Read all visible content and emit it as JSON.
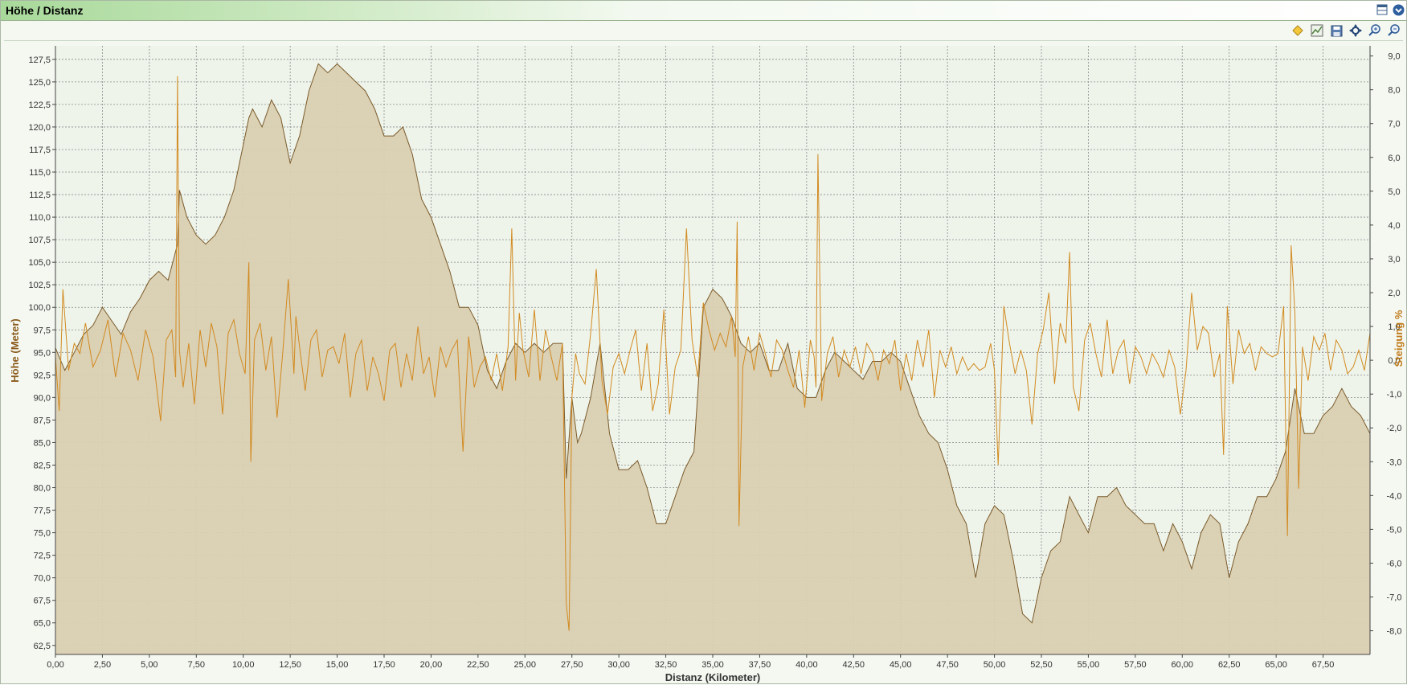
{
  "window": {
    "title": "Höhe / Distanz"
  },
  "icons": {
    "window": [
      "layout-icon",
      "chevron-down-icon"
    ],
    "toolbar": [
      "diamond-marker-icon",
      "chart-view-icon",
      "save-icon",
      "move-icon",
      "zoom-in-icon",
      "zoom-out-icon"
    ]
  },
  "colors": {
    "background": "#f4f8f1",
    "elevation_fill": "#d9cfb2",
    "elevation_line": "#7a5a2a",
    "gradient_line": "#d28a20",
    "grid": "#8a8a8a"
  },
  "chart_data": {
    "type": "area",
    "xlabel": "Distanz (Kilometer)",
    "ylabel": "Höhe (Meter)",
    "y2label": "Steigung %",
    "xlim": [
      0,
      70
    ],
    "ylim": [
      61.5,
      129
    ],
    "y2lim": [
      -8.7,
      9.3
    ],
    "x_ticks": [
      "0,00",
      "2,50",
      "5,00",
      "7,50",
      "10,00",
      "12,50",
      "15,00",
      "17,50",
      "20,00",
      "22,50",
      "25,00",
      "27,50",
      "30,00",
      "32,50",
      "35,00",
      "37,50",
      "40,00",
      "42,50",
      "45,00",
      "47,50",
      "50,00",
      "52,50",
      "55,00",
      "57,50",
      "60,00",
      "62,50",
      "65,00",
      "67,50"
    ],
    "y_ticks": [
      "62,5",
      "65,0",
      "67,5",
      "70,0",
      "72,5",
      "75,0",
      "77,5",
      "80,0",
      "82,5",
      "85,0",
      "87,5",
      "90,0",
      "92,5",
      "95,0",
      "97,5",
      "100,0",
      "102,5",
      "105,0",
      "107,5",
      "110,0",
      "112,5",
      "115,0",
      "117,5",
      "120,0",
      "122,5",
      "125,0",
      "127,5"
    ],
    "y2_ticks": [
      "-8,0",
      "-7,0",
      "-6,0",
      "-5,0",
      "-4,0",
      "-3,0",
      "-2,0",
      "-1,0",
      "0,0",
      "1,0",
      "2,0",
      "3,0",
      "4,0",
      "5,0",
      "6,0",
      "7,0",
      "8,0",
      "9,0"
    ],
    "grid": true,
    "series": [
      {
        "name": "Höhe (Meter)",
        "axis": "left",
        "style": "area",
        "x": [
          0,
          0.5,
          1,
          1.5,
          2,
          2.5,
          3,
          3.5,
          4,
          4.5,
          5,
          5.5,
          6,
          6.5,
          6.6,
          7,
          7.5,
          8,
          8.5,
          9,
          9.5,
          10,
          10.3,
          10.5,
          11,
          11.5,
          12,
          12.5,
          13,
          13.5,
          14,
          14.5,
          15,
          15.5,
          16,
          16.5,
          17,
          17.5,
          18,
          18.5,
          19,
          19.5,
          20,
          20.5,
          21,
          21.5,
          22,
          22.5,
          23,
          23.5,
          24,
          24.5,
          25,
          25.5,
          26,
          26.5,
          27,
          27.2,
          27.5,
          27.8,
          28,
          28.5,
          29,
          29.5,
          30,
          30.5,
          31,
          31.5,
          32,
          32.5,
          33,
          33.5,
          34,
          34.5,
          35,
          35.5,
          36,
          36.5,
          37,
          37.5,
          38,
          38.5,
          39,
          39.5,
          40,
          40.5,
          41,
          41.5,
          42,
          42.5,
          43,
          43.5,
          44,
          44.5,
          45,
          45.5,
          46,
          46.5,
          47,
          47.5,
          48,
          48.5,
          49,
          49.5,
          50,
          50.5,
          51,
          51.5,
          52,
          52.5,
          53,
          53.5,
          54,
          54.5,
          55,
          55.5,
          56,
          56.5,
          57,
          57.5,
          58,
          58.5,
          59,
          59.5,
          60,
          60.5,
          61,
          61.5,
          62,
          62.5,
          63,
          63.5,
          64,
          64.5,
          65,
          65.5,
          66,
          66.5,
          67,
          67.5,
          68,
          68.5,
          69,
          69.5,
          70
        ],
        "y": [
          95.5,
          93,
          95,
          97,
          98,
          100,
          98.5,
          97,
          99.5,
          101,
          103,
          104,
          103,
          107,
          113,
          110,
          108,
          107,
          108,
          110,
          113,
          118,
          121,
          122,
          120,
          123,
          121,
          116,
          119,
          124,
          127,
          126,
          127,
          126,
          125,
          124,
          122,
          119,
          119,
          120,
          117,
          112,
          110,
          107,
          104,
          100,
          100,
          98,
          93,
          91,
          94,
          96,
          95,
          96,
          95,
          96,
          96,
          81,
          90,
          85,
          86,
          90,
          96,
          86,
          82,
          82,
          83,
          80,
          76,
          76,
          79,
          82,
          84,
          100,
          102,
          101,
          99,
          96,
          95,
          96,
          93,
          93,
          96,
          91,
          90,
          90,
          93,
          95,
          94,
          93,
          92,
          94,
          94,
          95,
          94,
          91,
          88,
          86,
          85,
          82,
          78,
          76,
          70,
          76,
          78,
          77,
          72,
          66,
          65,
          70,
          73,
          74,
          79,
          77,
          75,
          79,
          79,
          80,
          78,
          77,
          76,
          76,
          73,
          76,
          74,
          71,
          75,
          77,
          76,
          70,
          74,
          76,
          79,
          79,
          81,
          84,
          91,
          86,
          86,
          88,
          89,
          91,
          89,
          88,
          86
        ]
      },
      {
        "name": "Steigung %",
        "axis": "right",
        "style": "line",
        "x": [
          0,
          0.2,
          0.4,
          0.7,
          1,
          1.3,
          1.6,
          2,
          2.4,
          2.8,
          3.2,
          3.6,
          4,
          4.4,
          4.8,
          5.2,
          5.6,
          5.9,
          6.2,
          6.4,
          6.5,
          6.6,
          6.8,
          7.1,
          7.4,
          7.7,
          8,
          8.3,
          8.6,
          8.9,
          9.2,
          9.5,
          9.8,
          10.1,
          10.3,
          10.4,
          10.6,
          10.9,
          11.2,
          11.5,
          11.8,
          12.1,
          12.4,
          12.7,
          12.8,
          13,
          13.3,
          13.6,
          13.9,
          14.2,
          14.5,
          14.8,
          15.1,
          15.4,
          15.7,
          16,
          16.3,
          16.6,
          16.9,
          17.2,
          17.5,
          17.8,
          18.1,
          18.4,
          18.7,
          19,
          19.3,
          19.6,
          19.9,
          20.2,
          20.5,
          20.8,
          21.1,
          21.4,
          21.7,
          22,
          22.3,
          22.6,
          22.9,
          23.2,
          23.5,
          23.8,
          24.1,
          24.3,
          24.5,
          24.7,
          24.9,
          25.2,
          25.5,
          25.8,
          26.1,
          26.4,
          26.7,
          27,
          27.2,
          27.35,
          27.5,
          27.7,
          27.9,
          28.2,
          28.5,
          28.8,
          29.1,
          29.4,
          29.7,
          30,
          30.3,
          30.6,
          30.9,
          31.2,
          31.5,
          31.8,
          32.1,
          32.4,
          32.7,
          33,
          33.3,
          33.6,
          33.9,
          34.2,
          34.5,
          34.8,
          35.1,
          35.4,
          35.7,
          36,
          36.2,
          36.3,
          36.4,
          36.6,
          36.9,
          37.2,
          37.5,
          37.8,
          38.1,
          38.4,
          38.7,
          39,
          39.3,
          39.6,
          39.9,
          40.2,
          40.4,
          40.5,
          40.6,
          40.8,
          41.1,
          41.4,
          41.7,
          42,
          42.3,
          42.6,
          42.9,
          43.2,
          43.5,
          43.8,
          44.1,
          44.4,
          44.7,
          45,
          45.3,
          45.6,
          45.9,
          46.2,
          46.5,
          46.8,
          47.1,
          47.4,
          47.7,
          48,
          48.3,
          48.6,
          48.9,
          49.2,
          49.5,
          49.8,
          50,
          50.2,
          50.5,
          50.8,
          51.1,
          51.4,
          51.7,
          52,
          52.3,
          52.6,
          52.9,
          53.2,
          53.5,
          53.8,
          54,
          54.2,
          54.5,
          54.8,
          55.1,
          55.4,
          55.7,
          56,
          56.3,
          56.6,
          56.9,
          57.2,
          57.5,
          57.8,
          58.1,
          58.4,
          58.7,
          59,
          59.3,
          59.6,
          59.9,
          60.2,
          60.5,
          60.8,
          61.1,
          61.4,
          61.7,
          62,
          62.2,
          62.4,
          62.7,
          63,
          63.3,
          63.6,
          63.9,
          64.2,
          64.5,
          64.8,
          65.1,
          65.4,
          65.6,
          65.8,
          66,
          66.2,
          66.4,
          66.7,
          67,
          67.3,
          67.6,
          67.9,
          68.2,
          68.5,
          68.8,
          69.1,
          69.4,
          69.7,
          70
        ],
        "y": [
          0.1,
          -1.5,
          2.1,
          -0.3,
          0.5,
          0.2,
          1.1,
          -0.2,
          0.3,
          1.2,
          -0.5,
          0.8,
          0.3,
          -0.6,
          0.9,
          0.1,
          -1.8,
          0.6,
          0.9,
          -0.5,
          8.4,
          0.3,
          -0.8,
          0.5,
          -1.3,
          0.9,
          -0.2,
          1.1,
          0.4,
          -1.6,
          0.8,
          1.2,
          0.2,
          -0.4,
          2.9,
          -3.0,
          0.6,
          1.1,
          -0.3,
          0.7,
          -1.7,
          0.2,
          2.4,
          -0.4,
          1.3,
          0.4,
          -0.9,
          0.6,
          0.9,
          -0.5,
          0.3,
          0.4,
          -0.1,
          0.8,
          -1.1,
          0.2,
          0.6,
          -0.9,
          0.1,
          -0.4,
          -1.2,
          0.3,
          0.5,
          -0.8,
          0.2,
          -0.6,
          1.0,
          -0.4,
          0.1,
          -1.1,
          0.4,
          -0.2,
          0.3,
          0.6,
          -2.7,
          0.7,
          -0.8,
          -0.2,
          0.1,
          -0.6,
          0.2,
          -0.9,
          0.4,
          3.9,
          -0.6,
          1.4,
          0.3,
          -0.5,
          1.5,
          -0.6,
          0.9,
          0.1,
          -0.6,
          0.5,
          -7.2,
          -8.0,
          -1.1,
          0.2,
          -0.4,
          -0.7,
          0.8,
          2.7,
          -0.6,
          -1.6,
          -0.2,
          0.2,
          -0.4,
          0.3,
          0.9,
          -0.9,
          0.5,
          -1.5,
          -0.7,
          1.5,
          -1.6,
          -0.2,
          0.3,
          3.9,
          0.6,
          -0.5,
          1.7,
          0.9,
          0.3,
          0.8,
          0.4,
          1.3,
          0.1,
          4.1,
          -4.9,
          -0.2,
          0.7,
          -0.3,
          0.8,
          0.2,
          -0.5,
          0.6,
          0.3,
          -0.3,
          -0.8,
          0.3,
          -1.4,
          0.6,
          0.1,
          -0.8,
          6.1,
          -1.2,
          0.2,
          0.7,
          -0.5,
          0.3,
          -0.2,
          0.4,
          -0.4,
          0.5,
          0.2,
          -0.6,
          0.3,
          -0.1,
          0.6,
          -0.9,
          0.2,
          -0.6,
          0.6,
          -0.2,
          0.9,
          -1.1,
          0.3,
          -0.2,
          0.4,
          -0.4,
          0.1,
          -0.3,
          -0.1,
          -0.3,
          -0.2,
          0.5,
          -0.3,
          -3.1,
          1.6,
          0.5,
          -0.4,
          0.3,
          -0.3,
          -1.9,
          0.2,
          0.9,
          2.0,
          -0.7,
          1.1,
          0.5,
          3.2,
          -0.8,
          -1.5,
          0.6,
          1.1,
          0.2,
          -0.5,
          1.2,
          -0.4,
          0.3,
          0.6,
          -0.7,
          0.4,
          0.1,
          -0.4,
          0.2,
          -0.1,
          -0.5,
          0.3,
          -0.2,
          -1.6,
          -0.3,
          2.0,
          0.3,
          1.0,
          0.8,
          -0.5,
          0.2,
          -2.8,
          1.6,
          -0.7,
          0.9,
          0.2,
          0.5,
          -0.3,
          0.4,
          0.2,
          0.1,
          0.2,
          1.6,
          -5.2,
          3.4,
          1.4,
          -3.8,
          0.4,
          -0.6,
          0.7,
          0.3,
          0.8,
          -0.3,
          0.6,
          0.3,
          -0.4,
          -0.2,
          0.3,
          -0.3,
          0.8
        ]
      }
    ]
  }
}
